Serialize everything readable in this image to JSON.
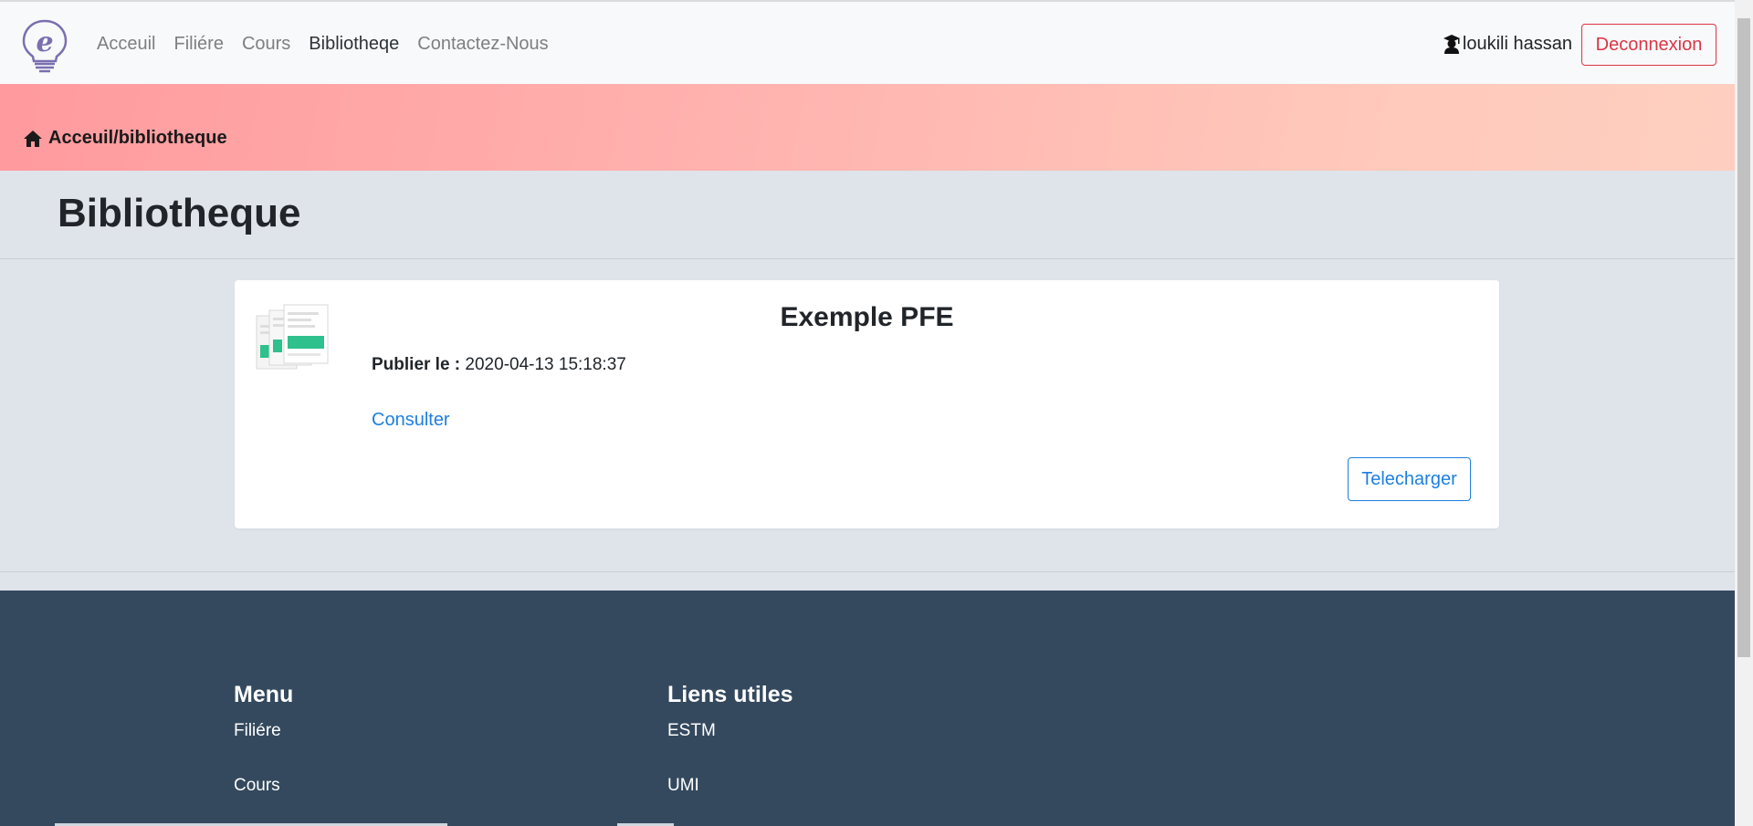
{
  "navbar": {
    "links": [
      "Acceuil",
      "Filiére",
      "Cours",
      "Bibliotheqe",
      "Contactez-Nous"
    ],
    "active_link": "Bibliotheqe",
    "user_name": "loukili hassan",
    "logout_label": "Deconnexion"
  },
  "banner": {
    "breadcrumb": "Acceuil/bibliotheque"
  },
  "page": {
    "title": "Bibliotheque"
  },
  "document": {
    "title": "Exemple PFE",
    "published_label": "Publier le :",
    "published_date": "2020-04-13 15:18:37",
    "consult_label": "Consulter",
    "download_label": "Telecharger"
  },
  "footer": {
    "menu_title": "Menu",
    "menu_links": [
      "Filiére",
      "Cours"
    ],
    "links_title": "Liens utiles",
    "useful_links": [
      "ESTM",
      "UMI"
    ]
  },
  "colors": {
    "danger": "#dc3545",
    "primary": "#1e7fe0",
    "footer_bg": "#34495e",
    "banner_gradient_start": "#ff9a9e",
    "banner_gradient_end": "#fecfc0"
  },
  "icons": {
    "logo": "lightbulb-e-logo-icon",
    "user": "graduate-user-icon",
    "breadcrumb": "home-icon",
    "document": "document-stack-icon"
  }
}
